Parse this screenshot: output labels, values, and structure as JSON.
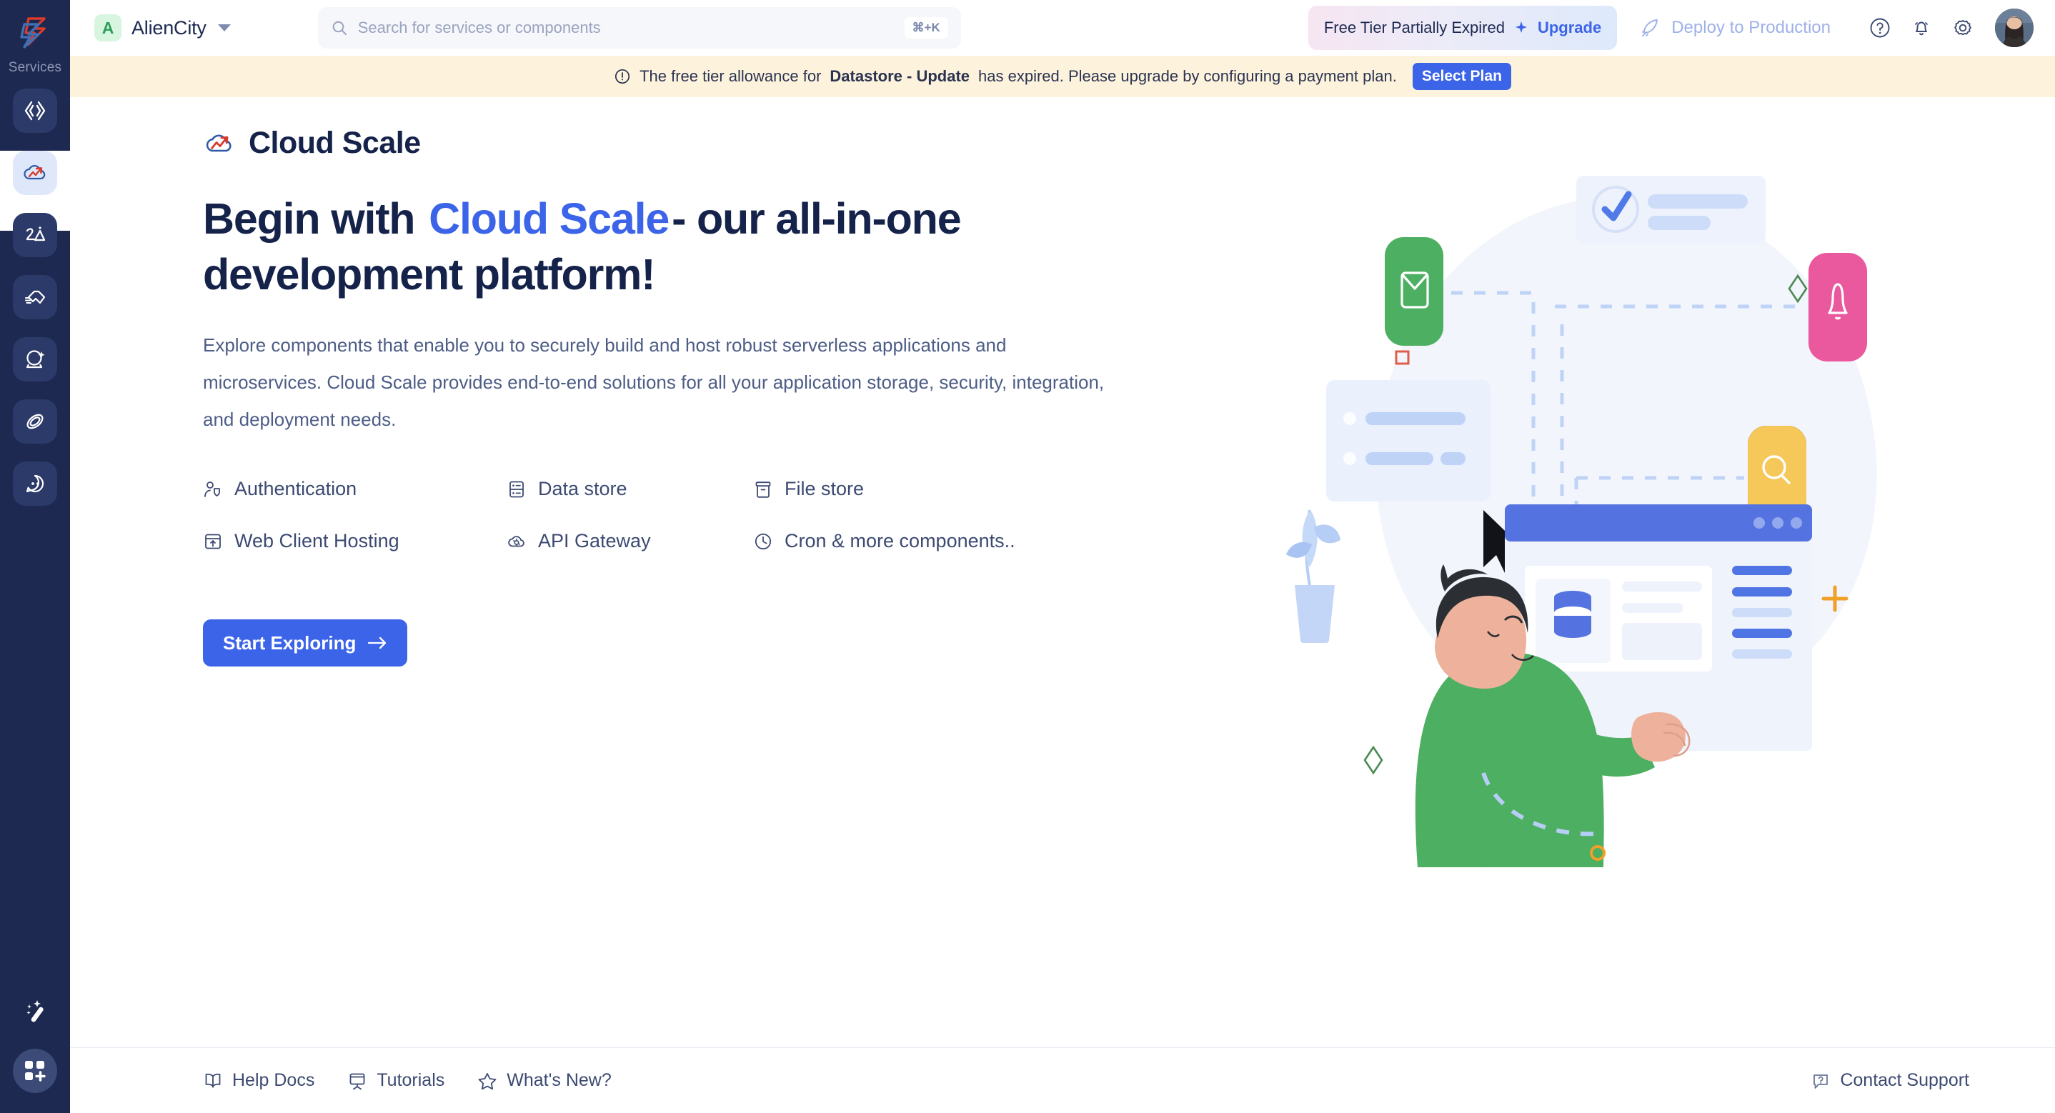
{
  "sidebar": {
    "label": "Services",
    "brand_icon": "zap-hexagon-logo",
    "items": [
      {
        "icon": "code-brackets-icon",
        "name": "code",
        "active": false
      },
      {
        "icon": "cloud-scale-icon",
        "name": "cloud-scale",
        "active": true
      },
      {
        "icon": "mountain-star-icon",
        "name": "insights",
        "active": false
      },
      {
        "icon": "handshake-icon",
        "name": "integrations",
        "active": false
      },
      {
        "icon": "crystal-ball-icon",
        "name": "predictions",
        "active": false
      },
      {
        "icon": "atom-orbit-icon",
        "name": "automation",
        "active": false
      },
      {
        "icon": "chat-face-icon",
        "name": "support-chat",
        "active": false
      }
    ],
    "bottom": [
      {
        "icon": "magic-wand-icon",
        "name": "magic-wand"
      },
      {
        "icon": "grid-plus-icon",
        "name": "add-app"
      }
    ]
  },
  "header": {
    "workspace": {
      "initial": "A",
      "name": "AlienCity",
      "caret": "chevron-down-icon"
    },
    "search": {
      "icon": "search-icon",
      "placeholder": "Search for services or components",
      "shortcut": "⌘+K"
    },
    "upgrade": {
      "status": "Free Tier Partially Expired",
      "icon": "sparkle-icon",
      "link": "Upgrade"
    },
    "deploy": {
      "icon": "rocket-icon",
      "label": "Deploy to Production"
    },
    "icons": [
      {
        "icon": "help-circle-icon",
        "name": "help"
      },
      {
        "icon": "bell-icon",
        "name": "notifications"
      },
      {
        "icon": "gear-icon",
        "name": "settings"
      }
    ],
    "avatar": "user-avatar"
  },
  "banner": {
    "icon": "alert-circle-icon",
    "text_before": "The free tier allowance for",
    "highlight": "Datastore - Update",
    "text_after": "has expired. Please upgrade by configuring a payment plan.",
    "button": "Select Plan"
  },
  "page": {
    "logo_icon": "cloud-scale-logo",
    "title": "Cloud Scale",
    "heading_before": "Begin with",
    "heading_highlight": "Cloud Scale",
    "heading_after": "- our all-in-one development platform!",
    "lead": "Explore components that enable you to securely build and host robust serverless applications and microservices. Cloud Scale provides end-to-end solutions for all your application storage, security, integration, and deployment needs.",
    "features": [
      {
        "icon": "user-shield-icon",
        "label": "Authentication"
      },
      {
        "icon": "database-icon",
        "label": "Data store"
      },
      {
        "icon": "file-box-icon",
        "label": "File store"
      },
      {
        "icon": "browser-upload-icon",
        "label": "Web Client Hosting"
      },
      {
        "icon": "api-cloud-icon",
        "label": "API Gateway"
      },
      {
        "icon": "clock-icon",
        "label": "Cron & more components.."
      }
    ],
    "cta": "Start Exploring",
    "cta_icon": "arrow-right-icon"
  },
  "footer": {
    "links": [
      {
        "icon": "book-icon",
        "label": "Help Docs"
      },
      {
        "icon": "presentation-icon",
        "label": "Tutorials"
      },
      {
        "icon": "star-icon",
        "label": "What's New?"
      }
    ],
    "support": {
      "icon": "chat-question-icon",
      "label": "Contact Support"
    }
  },
  "colors": {
    "sidebar_bg": "#1d2951",
    "accent_blue": "#3c64e8",
    "banner_bg": "#fdf3dd",
    "highlight_yellow": "#f7d65e",
    "text_dark": "#15224a",
    "text_muted": "#4e5d86"
  }
}
